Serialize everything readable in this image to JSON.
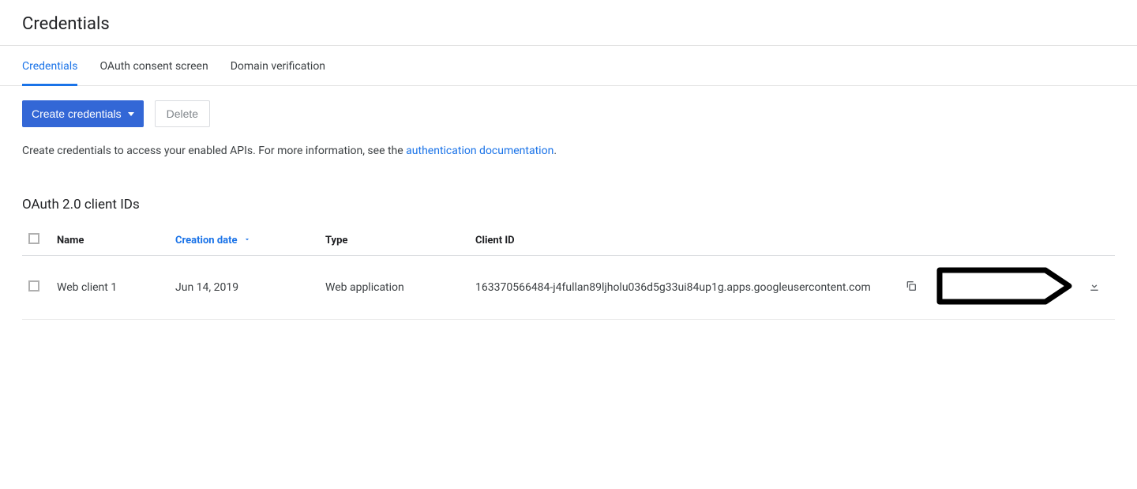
{
  "page": {
    "title": "Credentials"
  },
  "tabs": [
    {
      "label": "Credentials",
      "active": true
    },
    {
      "label": "OAuth consent screen",
      "active": false
    },
    {
      "label": "Domain verification",
      "active": false
    }
  ],
  "actions": {
    "create_label": "Create credentials",
    "delete_label": "Delete"
  },
  "help": {
    "text_before": "Create credentials to access your enabled APIs. For more information, see the ",
    "link_text": "authentication documentation",
    "text_after": "."
  },
  "section": {
    "title": "OAuth 2.0 client IDs"
  },
  "table": {
    "headers": {
      "name": "Name",
      "creation_date": "Creation date",
      "type": "Type",
      "client_id": "Client ID"
    },
    "rows": [
      {
        "name": "Web client 1",
        "creation_date": "Jun 14, 2019",
        "type": "Web application",
        "client_id": "163370566484-j4fullan89ljholu036d5g33ui84up1g.apps.googleusercontent.com"
      }
    ]
  }
}
